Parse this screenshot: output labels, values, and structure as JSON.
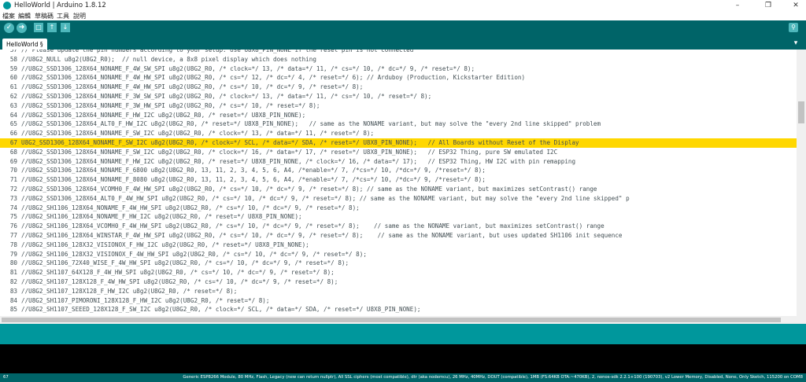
{
  "window": {
    "title": "HelloWorld | Arduino 1.8.12",
    "controls": [
      "minimize-icon",
      "maximize-icon",
      "close-icon"
    ]
  },
  "menu": {
    "items": [
      "檔案",
      "編輯",
      "草稿碼",
      "工具",
      "說明"
    ]
  },
  "toolbar": {
    "verify_icon": "check-icon",
    "upload_icon": "arrow-right-icon",
    "new_icon": "new-file-icon",
    "open_icon": "arrow-up-icon",
    "save_icon": "arrow-down-icon",
    "serial_monitor_icon": "magnifier-icon"
  },
  "tabs": [
    {
      "label": "HelloWorld §"
    }
  ],
  "editor": {
    "lines": [
      {
        "num": "57",
        "text": "// Please update the pin numbers according to your setup. Use U8X8_PIN_NONE if the reset pin is not connected",
        "highlight": false
      },
      {
        "num": "58",
        "text": "//U8G2_NULL u8g2(U8G2_R0);  // null device, a 8x8 pixel display which does nothing",
        "highlight": false
      },
      {
        "num": "59",
        "text": "//U8G2_SSD1306_128X64_NONAME_F_4W_SW_SPI u8g2(U8G2_R0, /* clock=*/ 13, /* data=*/ 11, /* cs=*/ 10, /* dc=*/ 9, /* reset=*/ 8);",
        "highlight": false
      },
      {
        "num": "60",
        "text": "//U8G2_SSD1306_128X64_NONAME_F_4W_HW_SPI u8g2(U8G2_R0, /* cs=*/ 12, /* dc=*/ 4, /* reset=*/ 6); // Arduboy (Production, Kickstarter Edition)",
        "highlight": false
      },
      {
        "num": "61",
        "text": "//U8G2_SSD1306_128X64_NONAME_F_4W_HW_SPI u8g2(U8G2_R0, /* cs=*/ 10, /* dc=*/ 9, /* reset=*/ 8);",
        "highlight": false
      },
      {
        "num": "62",
        "text": "//U8G2_SSD1306_128X64_NONAME_F_3W_SW_SPI u8g2(U8G2_R0, /* clock=*/ 13, /* data=*/ 11, /* cs=*/ 10, /* reset=*/ 8);",
        "highlight": false
      },
      {
        "num": "63",
        "text": "//U8G2_SSD1306_128X64_NONAME_F_3W_HW_SPI u8g2(U8G2_R0, /* cs=*/ 10, /* reset=*/ 8);",
        "highlight": false
      },
      {
        "num": "64",
        "text": "//U8G2_SSD1306_128X64_NONAME_F_HW_I2C u8g2(U8G2_R0, /* reset=*/ U8X8_PIN_NONE);",
        "highlight": false
      },
      {
        "num": "65",
        "text": "//U8G2_SSD1306_128X64_ALT0_F_HW_I2C u8g2(U8G2_R0, /* reset=*/ U8X8_PIN_NONE);   // same as the NONAME variant, but may solve the \"every 2nd line skipped\" problem",
        "highlight": false
      },
      {
        "num": "66",
        "text": "//U8G2_SSD1306_128X64_NONAME_F_SW_I2C u8g2(U8G2_R0, /* clock=*/ 13, /* data=*/ 11, /* reset=*/ 8);",
        "highlight": false
      },
      {
        "num": "67",
        "text": "U8G2_SSD1306_128X64_NONAME_F_SW_I2C u8g2(U8G2_R0, /* clock=*/ SCL, /* data=*/ SDA, /* reset=*/ U8X8_PIN_NONE);   // All Boards without Reset of the Display",
        "highlight": true
      },
      {
        "num": "68",
        "text": "//U8G2_SSD1306_128X64_NONAME_F_SW_I2C u8g2(U8G2_R0, /* clock=*/ 16, /* data=*/ 17, /* reset=*/ U8X8_PIN_NONE);   // ESP32 Thing, pure SW emulated I2C",
        "highlight": false
      },
      {
        "num": "69",
        "text": "//U8G2_SSD1306_128X64_NONAME_F_HW_I2C u8g2(U8G2_R0, /* reset=*/ U8X8_PIN_NONE, /* clock=*/ 16, /* data=*/ 17);   // ESP32 Thing, HW I2C with pin remapping",
        "highlight": false
      },
      {
        "num": "70",
        "text": "//U8G2_SSD1306_128X64_NONAME_F_6800 u8g2(U8G2_R0, 13, 11, 2, 3, 4, 5, 6, A4, /*enable=*/ 7, /*cs=*/ 10, /*dc=*/ 9, /*reset=*/ 8);",
        "highlight": false
      },
      {
        "num": "71",
        "text": "//U8G2_SSD1306_128X64_NONAME_F_8080 u8g2(U8G2_R0, 13, 11, 2, 3, 4, 5, 6, A4, /*enable=*/ 7, /*cs=*/ 10, /*dc=*/ 9, /*reset=*/ 8);",
        "highlight": false
      },
      {
        "num": "72",
        "text": "//U8G2_SSD1306_128X64_VCOMH0_F_4W_HW_SPI u8g2(U8G2_R0, /* cs=*/ 10, /* dc=*/ 9, /* reset=*/ 8); // same as the NONAME variant, but maximizes setContrast() range",
        "highlight": false
      },
      {
        "num": "73",
        "text": "//U8G2_SSD1306_128X64_ALT0_F_4W_HW_SPI u8g2(U8G2_R0, /* cs=*/ 10, /* dc=*/ 9, /* reset=*/ 8); // same as the NONAME variant, but may solve the \"every 2nd line skipped\" p",
        "highlight": false
      },
      {
        "num": "74",
        "text": "//U8G2_SH1106_128X64_NONAME_F_4W_HW_SPI u8g2(U8G2_R0, /* cs=*/ 10, /* dc=*/ 9, /* reset=*/ 8);",
        "highlight": false
      },
      {
        "num": "75",
        "text": "//U8G2_SH1106_128X64_NONAME_F_HW_I2C u8g2(U8G2_R0, /* reset=*/ U8X8_PIN_NONE);",
        "highlight": false
      },
      {
        "num": "76",
        "text": "//U8G2_SH1106_128X64_VCOMH0_F_4W_HW_SPI u8g2(U8G2_R0, /* cs=*/ 10, /* dc=*/ 9, /* reset=*/ 8);    // same as the NONAME variant, but maximizes setContrast() range",
        "highlight": false
      },
      {
        "num": "77",
        "text": "//U8G2_SH1106_128X64_WINSTAR_F_4W_HW_SPI u8g2(U8G2_R0, /* cs=*/ 10, /* dc=*/ 9, /* reset=*/ 8);    // same as the NONAME variant, but uses updated SH1106 init sequence",
        "highlight": false
      },
      {
        "num": "78",
        "text": "//U8G2_SH1106_128X32_VISIONOX_F_HW_I2C u8g2(U8G2_R0, /* reset=*/ U8X8_PIN_NONE);",
        "highlight": false
      },
      {
        "num": "79",
        "text": "//U8G2_SH1106_128X32_VISIONOX_F_4W_HW_SPI u8g2(U8G2_R0, /* cs=*/ 10, /* dc=*/ 9, /* reset=*/ 8);",
        "highlight": false
      },
      {
        "num": "80",
        "text": "//U8G2_SH1106_72X40_WISE_F_4W_HW_SPI u8g2(U8G2_R0, /* cs=*/ 10, /* dc=*/ 9, /* reset=*/ 8);",
        "highlight": false
      },
      {
        "num": "81",
        "text": "//U8G2_SH1107_64X128_F_4W_HW_SPI u8g2(U8G2_R0, /* cs=*/ 10, /* dc=*/ 9, /* reset=*/ 8);",
        "highlight": false
      },
      {
        "num": "82",
        "text": "//U8G2_SH1107_128X128_F_4W_HW_SPI u8g2(U8G2_R0, /* cs=*/ 10, /* dc=*/ 9, /* reset=*/ 8);",
        "highlight": false
      },
      {
        "num": "83",
        "text": "//U8G2_SH1107_128X128_F_HW_I2C u8g2(U8G2_R0, /* reset=*/ 8);",
        "highlight": false
      },
      {
        "num": "84",
        "text": "//U8G2_SH1107_PIMORONI_128X128_F_HW_I2C u8g2(U8G2_R0, /* reset=*/ 8);",
        "highlight": false
      },
      {
        "num": "85",
        "text": "//U8G2_SH1107_SEEED_128X128_F_SW_I2C u8g2(U8G2_R0, /* clock=*/ SCL, /* data=*/ SDA, /* reset=*/ U8X8_PIN_NONE);",
        "highlight": false
      }
    ]
  },
  "status": {
    "line_number": "67",
    "board": "Generic ESP8266 Module, 80 MHz, Flash, Legacy (new can return nullptr), All SSL ciphers (most compatible), dtr (aka nodemcu), 26 MHz, 40MHz, DOUT (compatible), 1MB (FS:64KB OTA:~470KB), 2, nonos-sdk 2.2.1+100 (190703), v2 Lower Memory, Disabled, None, Only Sketch, 115200 on COM8"
  },
  "colors": {
    "toolbar": "#006468",
    "button": "#4db7bb",
    "message_bar": "#00979c",
    "highlight": "#ffd700"
  }
}
